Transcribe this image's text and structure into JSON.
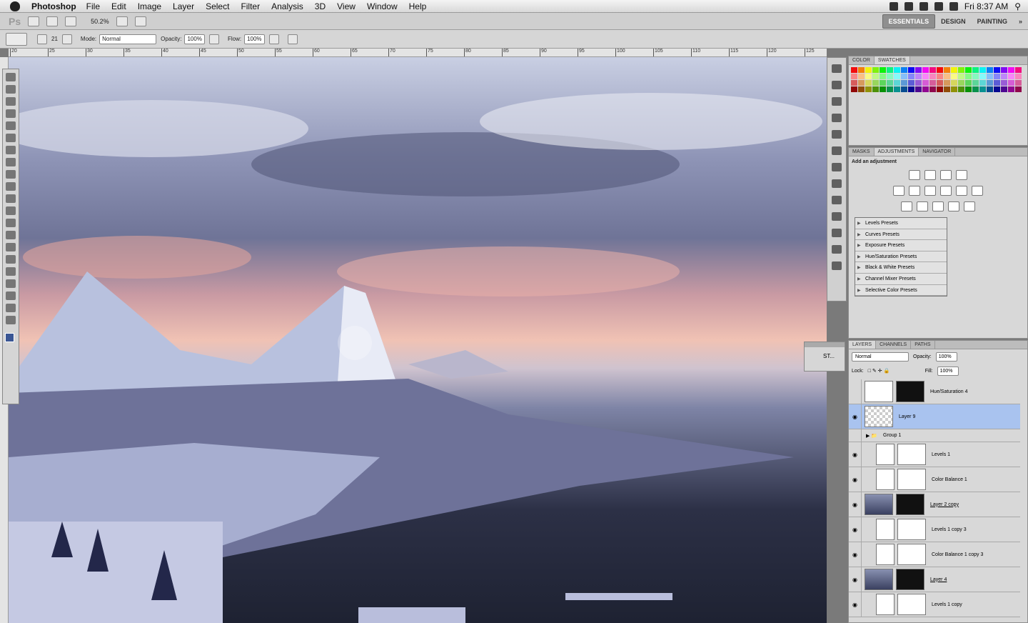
{
  "menubar": {
    "app": "Photoshop",
    "items": [
      "File",
      "Edit",
      "Image",
      "Layer",
      "Select",
      "Filter",
      "Analysis",
      "3D",
      "View",
      "Window",
      "Help"
    ],
    "clock": "Fri 8:37 AM"
  },
  "appbar": {
    "logo": "Ps",
    "zoom": "50.2%",
    "workspaces": [
      "ESSENTIALS",
      "DESIGN",
      "PAINTING"
    ]
  },
  "options": {
    "mode_label": "Mode:",
    "mode_value": "Normal",
    "opacity_label": "Opacity:",
    "opacity_value": "100%",
    "flow_label": "Flow:",
    "flow_value": "100%",
    "brush_size": "21"
  },
  "ruler": {
    "ticks": [
      "20",
      "25",
      "30",
      "35",
      "40",
      "45",
      "50",
      "55",
      "60",
      "65",
      "70",
      "75",
      "80",
      "85",
      "90",
      "95",
      "100",
      "105",
      "110",
      "115",
      "120",
      "125"
    ]
  },
  "small_panel": {
    "label": "ST..."
  },
  "color_panel": {
    "tabs": [
      "COLOR",
      "SWATCHES"
    ]
  },
  "adjust_panel": {
    "tabs": [
      "MASKS",
      "ADJUSTMENTS",
      "NAVIGATOR"
    ],
    "heading": "Add an adjustment",
    "presets": [
      "Levels Presets",
      "Curves Presets",
      "Exposure Presets",
      "Hue/Saturation Presets",
      "Black & White Presets",
      "Channel Mixer Presets",
      "Selective Color Presets"
    ]
  },
  "layers_panel": {
    "tabs": [
      "LAYERS",
      "CHANNELS",
      "PATHS"
    ],
    "blend": "Normal",
    "opacity_label": "Opacity:",
    "opacity": "100%",
    "lock_label": "Lock:",
    "fill_label": "Fill:",
    "fill": "100%",
    "layers": [
      {
        "name": "Hue/Saturation 4"
      },
      {
        "name": "Layer 9"
      },
      {
        "name": "Group 1"
      },
      {
        "name": "Levels 1"
      },
      {
        "name": "Color Balance 1"
      },
      {
        "name": "Layer 2 copy"
      },
      {
        "name": "Levels 1 copy 3"
      },
      {
        "name": "Color Balance 1 copy 3"
      },
      {
        "name": "Layer 4"
      },
      {
        "name": "Levels 1 copy"
      }
    ]
  }
}
